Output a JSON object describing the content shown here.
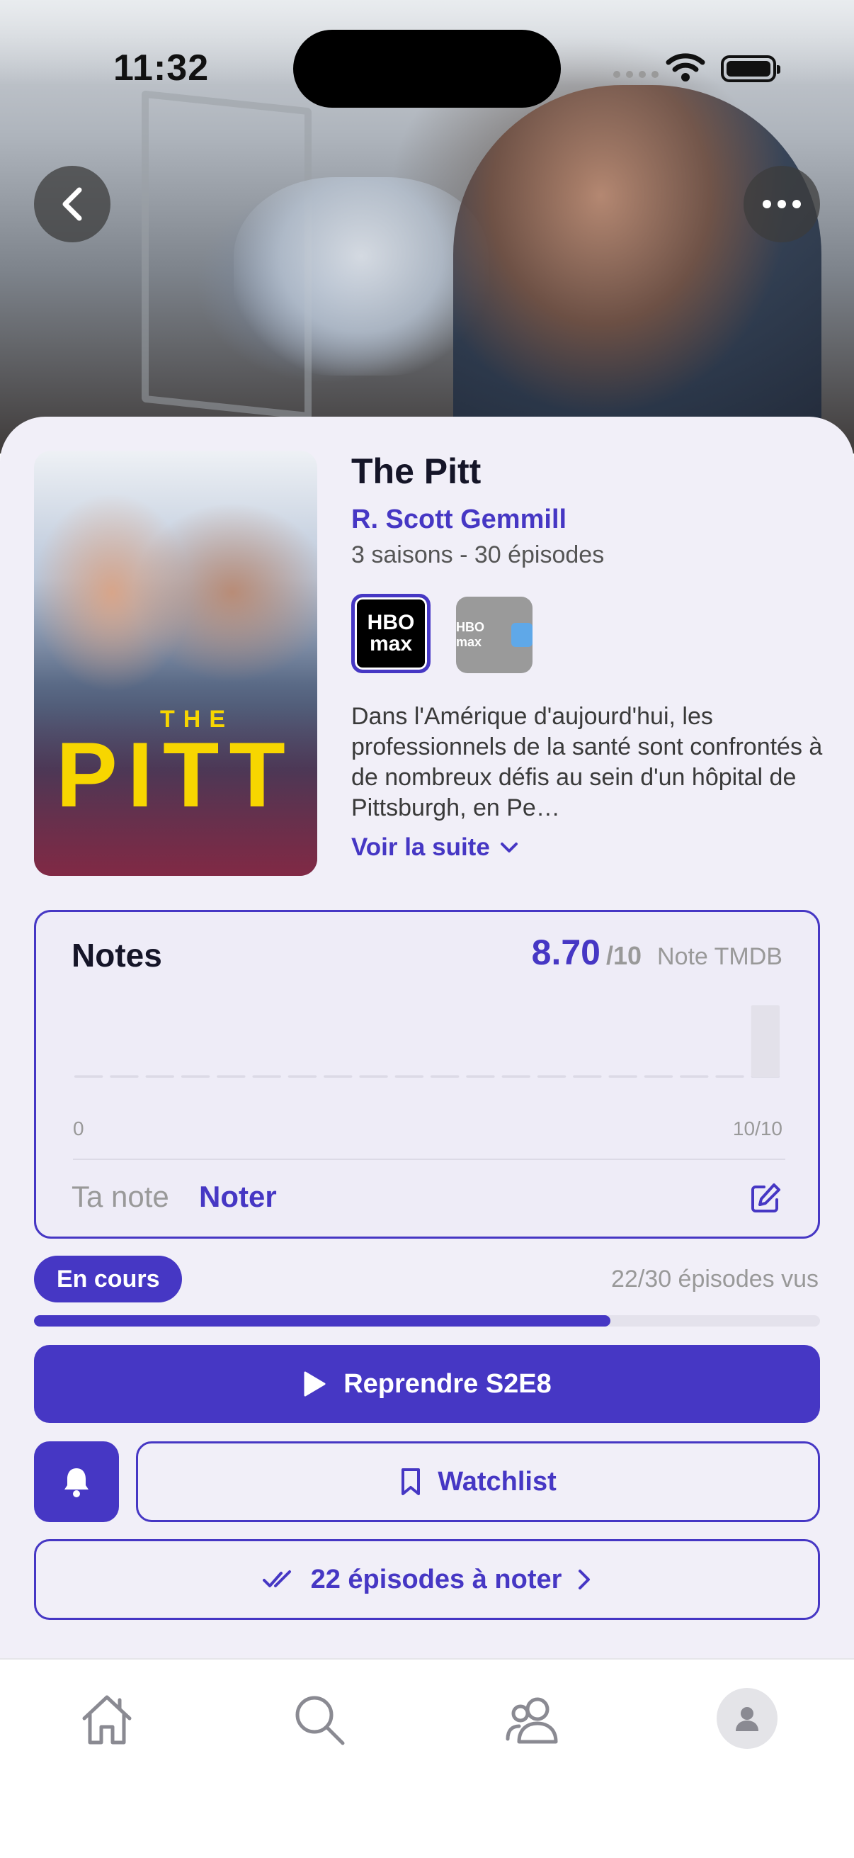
{
  "status_bar": {
    "time": "11:32"
  },
  "header": {
    "back_icon": "chevron-left-icon",
    "more_icon": "ellipsis-icon"
  },
  "show": {
    "poster_text_top": "THE",
    "poster_text_main": "PITT",
    "title": "The Pitt",
    "creator": "R. Scott Gemmill",
    "meta": "3 saisons - 30 épisodes",
    "providers": [
      {
        "name": "HBO max",
        "label": "HBO max"
      },
      {
        "name": "HBO Max Amazon Channel",
        "label": "HBO max"
      }
    ],
    "description": "Dans l'Amérique d'aujourd'hui, les professionnels de la santé sont confrontés à de nombreux défis au sein d'un hôpital de Pittsburgh, en Pe…",
    "read_more": "Voir la suite"
  },
  "ratings": {
    "title": "Notes",
    "score": "8.70",
    "score_max": "/10",
    "source": "Note TMDB",
    "axis_min": "0",
    "axis_max": "10/10",
    "your_rating_label": "Ta note",
    "rate_link": "Noter"
  },
  "chart_data": {
    "type": "bar",
    "categories": [
      "1",
      "2",
      "3",
      "4",
      "5",
      "6",
      "7",
      "8",
      "9",
      "10",
      "11",
      "12",
      "13",
      "14",
      "15",
      "16",
      "17",
      "18",
      "19",
      "20"
    ],
    "values": [
      0,
      0,
      0,
      0,
      0,
      0,
      0,
      0,
      0,
      0,
      0,
      0,
      0,
      0,
      0,
      0,
      0,
      0,
      0,
      1
    ],
    "xlabel": "",
    "ylabel": "",
    "xlim": [
      "0",
      "10/10"
    ]
  },
  "progress": {
    "status": "En cours",
    "episodes_watched": "22/30 épisodes vus",
    "fraction": 0.733
  },
  "actions": {
    "resume": "Reprendre S2E8",
    "watchlist": "Watchlist",
    "rate_episodes": "22 épisodes à noter"
  },
  "colors": {
    "accent": "#4637c4",
    "sheet_bg": "#f1eff8"
  },
  "tabbar": {
    "items": [
      {
        "name": "home",
        "icon": "home-icon"
      },
      {
        "name": "search",
        "icon": "search-icon"
      },
      {
        "name": "social",
        "icon": "people-icon"
      },
      {
        "name": "profile",
        "icon": "avatar-icon"
      }
    ]
  }
}
